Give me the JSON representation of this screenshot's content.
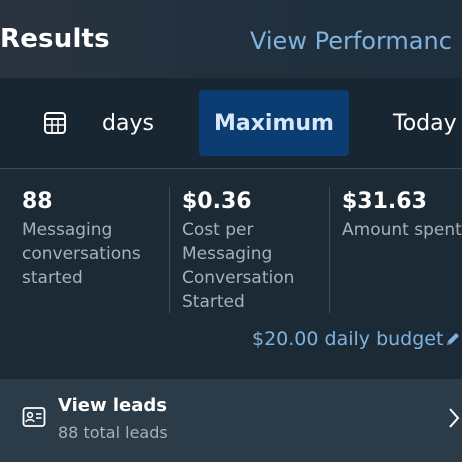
{
  "header": {
    "title": "Results",
    "link": "View Performanc"
  },
  "tabs": {
    "days_label": "days",
    "maximum_label": "Maximum",
    "today_label": "Today",
    "days_icon": "calendar-grid-icon"
  },
  "metrics": [
    {
      "value": "88",
      "desc": "Messaging conversations started"
    },
    {
      "value": "$0.36",
      "desc": "Cost per Messaging Conversation Started"
    },
    {
      "value": "$31.63",
      "desc": "Amount spent"
    }
  ],
  "budget": {
    "label": "$20.00 daily budget",
    "icon": "pencil-icon"
  },
  "leads": {
    "title": "View leads",
    "subtitle": "88 total leads",
    "icon": "contact-card-icon",
    "chevron_icon": "chevron-right-icon"
  },
  "colors": {
    "accent_link": "#7fb2de",
    "selected_tab_bg": "#0b3d73",
    "background": "#1b2a35"
  }
}
